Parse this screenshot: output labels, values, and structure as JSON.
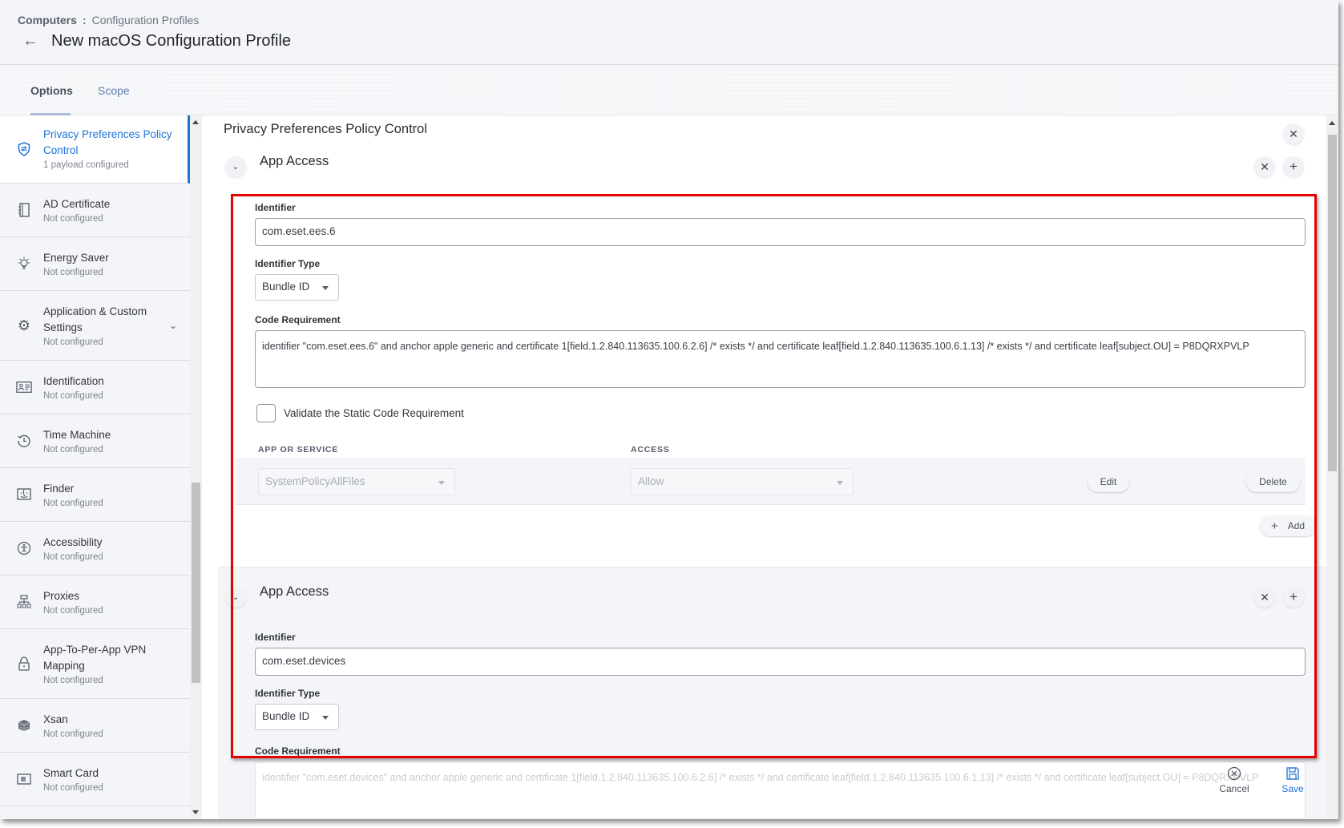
{
  "header": {
    "breadcrumb_root": "Computers",
    "breadcrumb_separator": ":",
    "breadcrumb_current": "Configuration Profiles",
    "title": "New macOS Configuration Profile",
    "back_icon": "arrow-left-icon"
  },
  "tabs": [
    {
      "label": "Options",
      "active": true
    },
    {
      "label": "Scope",
      "active": false
    }
  ],
  "sidebar": {
    "items": [
      {
        "label": "Privacy Preferences Policy Control",
        "status": "1 payload configured",
        "icon": "shield-settings-icon",
        "active": true
      },
      {
        "label": "AD Certificate",
        "status": "Not configured",
        "icon": "certificate-icon"
      },
      {
        "label": "Energy Saver",
        "status": "Not configured",
        "icon": "lightbulb-icon"
      },
      {
        "label": "Application & Custom Settings",
        "status": "Not configured",
        "icon": "gear-icon",
        "expandable": true
      },
      {
        "label": "Identification",
        "status": "Not configured",
        "icon": "id-card-icon"
      },
      {
        "label": "Time Machine",
        "status": "Not configured",
        "icon": "history-icon"
      },
      {
        "label": "Finder",
        "status": "Not configured",
        "icon": "finder-icon"
      },
      {
        "label": "Accessibility",
        "status": "Not configured",
        "icon": "accessibility-icon"
      },
      {
        "label": "Proxies",
        "status": "Not configured",
        "icon": "network-icon"
      },
      {
        "label": "App-To-Per-App VPN Mapping",
        "status": "Not configured",
        "icon": "lock-icon"
      },
      {
        "label": "Xsan",
        "status": "Not configured",
        "icon": "xsan-icon"
      },
      {
        "label": "Smart Card",
        "status": "Not configured",
        "icon": "smart-card-icon"
      }
    ]
  },
  "main": {
    "title": "Privacy Preferences Policy Control",
    "payloads": [
      {
        "section_title": "App Access",
        "identifier_label": "Identifier",
        "identifier_value": "com.eset.ees.6",
        "identifier_type_label": "Identifier Type",
        "identifier_type_value": "Bundle ID",
        "code_requirement_label": "Code Requirement",
        "code_requirement_value": "identifier \"com.eset.ees.6\" and anchor apple generic and certificate 1[field.1.2.840.113635.100.6.2.6] /* exists */ and certificate leaf[field.1.2.840.113635.100.6.1.13] /* exists */ and certificate leaf[subject.OU] = P8DQRXPVLP",
        "validate_label": "Validate the Static Code Requirement",
        "validate_checked": false,
        "table": {
          "columns": [
            "APP OR SERVICE",
            "ACCESS"
          ],
          "rows": [
            {
              "service": "SystemPolicyAllFiles",
              "access": "Allow",
              "edit_label": "Edit",
              "delete_label": "Delete"
            }
          ],
          "add_label": "Add"
        }
      },
      {
        "section_title": "App Access",
        "identifier_label": "Identifier",
        "identifier_value": "com.eset.devices",
        "identifier_type_label": "Identifier Type",
        "identifier_type_value": "Bundle ID",
        "code_requirement_label": "Code Requirement",
        "code_requirement_value": "identifier \"com.eset.devices\" and anchor apple generic and certificate 1[field.1.2.840.113635.100.6.2.6] /* exists */ and certificate leaf[field.1.2.840.113635.100.6.1.13] /* exists */ and certificate leaf[subject.OU] = P8DQRXPVLP"
      }
    ]
  },
  "footer": {
    "cancel_label": "Cancel",
    "save_label": "Save"
  },
  "colors": {
    "accent": "#1c73d9",
    "highlight_box": "#e60000"
  }
}
